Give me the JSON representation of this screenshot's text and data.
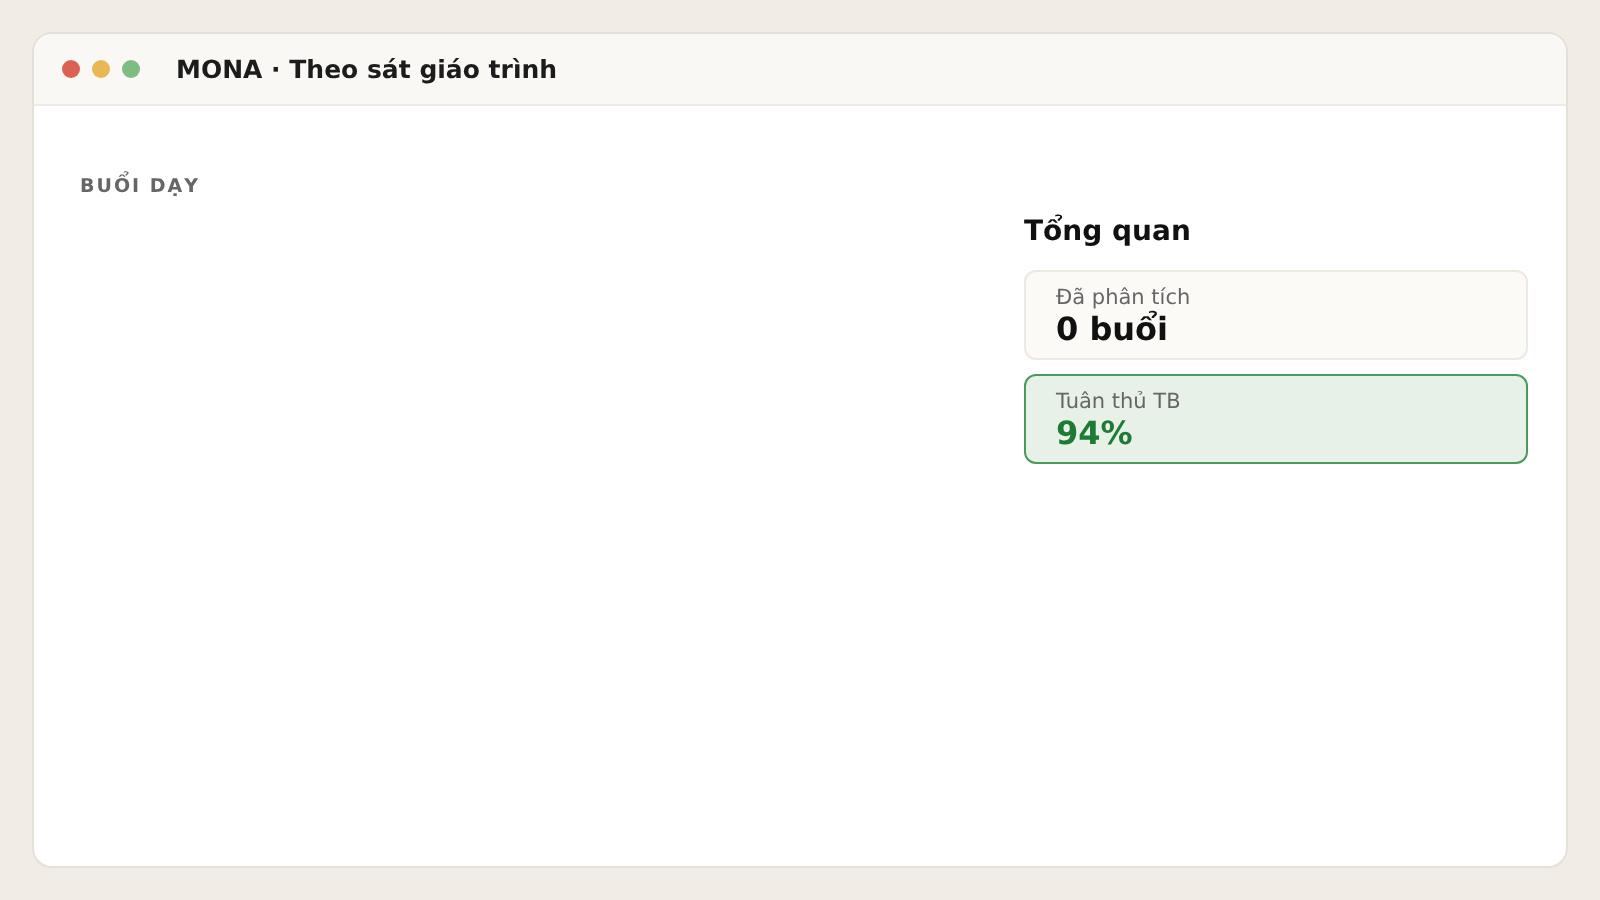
{
  "window": {
    "title": "MONA · Theo sát giáo trình"
  },
  "sessions": {
    "heading": "BUỔI DẠY"
  },
  "overview": {
    "heading": "Tổng quan",
    "stats": [
      {
        "label": "Đã phân tích",
        "value": "0 buổi",
        "kind": "neutral"
      },
      {
        "label": "Tuân thủ TB",
        "value": "94%",
        "kind": "success"
      }
    ]
  }
}
